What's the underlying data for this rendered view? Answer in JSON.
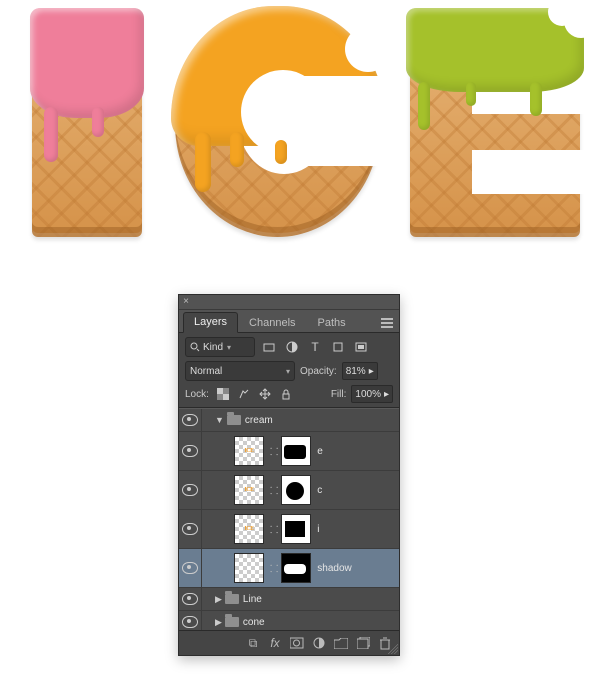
{
  "artwork": {
    "text": "ICE"
  },
  "panel": {
    "tabs": [
      "Layers",
      "Channels",
      "Paths"
    ],
    "active_tab": 0,
    "filter": {
      "label": "Kind"
    },
    "blend_mode": "Normal",
    "opacity": {
      "label": "Opacity:",
      "value": "81%"
    },
    "lock": {
      "label": "Lock:"
    },
    "fill": {
      "label": "Fill:",
      "value": "100%"
    },
    "group": {
      "name": "cream"
    },
    "layers": [
      {
        "name": "e"
      },
      {
        "name": "c"
      },
      {
        "name": "i"
      },
      {
        "name": "shadow",
        "selected": true
      }
    ],
    "collapsed_groups": [
      {
        "name": "Line"
      },
      {
        "name": "cone"
      }
    ]
  }
}
